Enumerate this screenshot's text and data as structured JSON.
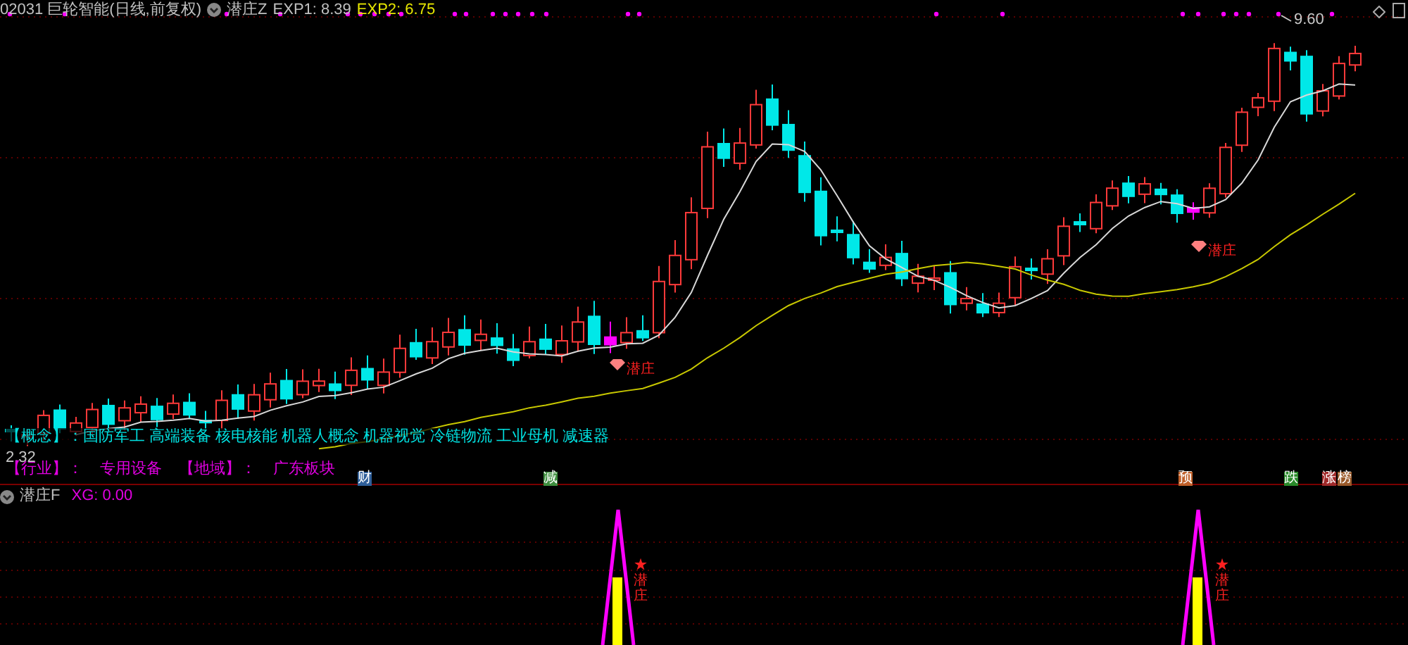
{
  "header": {
    "symbol": "02031 巨轮智能(日线,前复权)",
    "indicator": "潜庄Z",
    "exp1": "EXP1: 8.39",
    "exp2": "EXP2: 6.75"
  },
  "price_labels": {
    "high": "9.60",
    "low": "2.32"
  },
  "signals": [
    {
      "label": "潜庄"
    },
    {
      "label": "潜庄"
    }
  ],
  "concepts": "【概念】：国防军工 高端装备 核电核能 机器人概念 机器视觉 冷链物流 工业母机 减速器",
  "industry": {
    "label": "【行业】：",
    "value": "专用设备"
  },
  "region": {
    "label": "【地域】：",
    "value": "广东板块"
  },
  "events": [
    {
      "label": "财",
      "color": "#2f5f9a"
    },
    {
      "label": "减",
      "color": "#3f8f3f"
    },
    {
      "label": "预",
      "color": "#c0602a"
    },
    {
      "label": "跌",
      "color": "#2a8a2a"
    },
    {
      "label": "涨",
      "color": "#a02a2a"
    },
    {
      "label": "榜",
      "color": "#9a5a2a"
    }
  ],
  "sub_panel": {
    "title": "潜庄F",
    "value": "XG: 0.00",
    "markers": [
      {
        "label": "★潜庄"
      },
      {
        "label": "★潜庄"
      }
    ]
  }
}
